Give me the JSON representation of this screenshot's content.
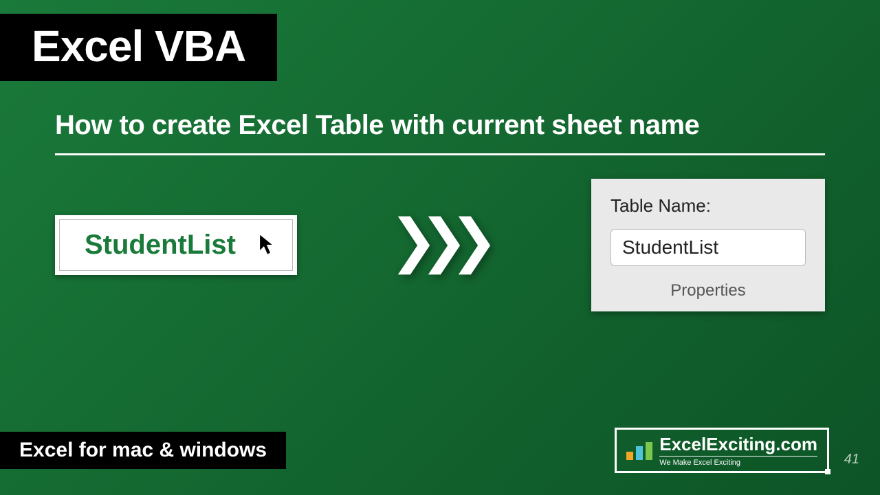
{
  "title": "Excel VBA",
  "subtitle": "How to create Excel Table with current sheet name",
  "sheet_tab": "StudentList",
  "panel": {
    "label": "Table Name:",
    "value": "StudentList",
    "footer": "Properties"
  },
  "platform": "Excel for mac & windows",
  "brand": {
    "name": "ExcelExciting.com",
    "tagline": "We Make Excel Exciting"
  },
  "page_number": "41"
}
